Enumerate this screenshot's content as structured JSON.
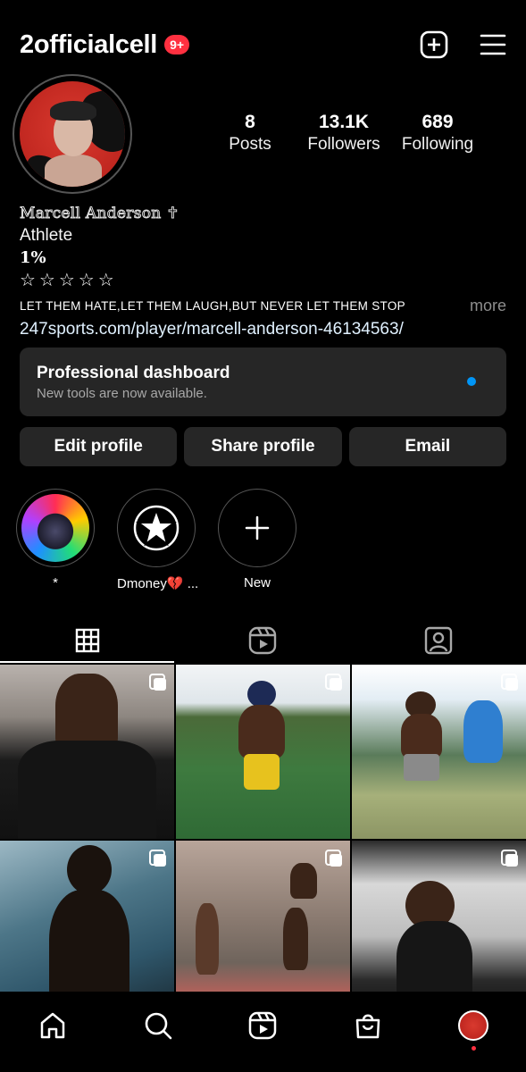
{
  "header": {
    "username": "2officialcell",
    "notification_badge": "9+",
    "icons": [
      "create-icon",
      "menu-icon"
    ]
  },
  "stats": [
    {
      "number": "8",
      "label": "Posts"
    },
    {
      "number": "13.1K",
      "label": "Followers"
    },
    {
      "number": "689",
      "label": "Following"
    }
  ],
  "bio": {
    "name": "Marcell Anderson ✝",
    "category": "Athlete",
    "line1": "1%",
    "stars": "☆☆☆☆☆",
    "motto": "LET THEM HATE,LET THEM LAUGH,BUT NEVER LET THEM STOP",
    "more": "more",
    "link": "247sports.com/player/marcell-anderson-46134563/"
  },
  "dashboard": {
    "title": "Professional dashboard",
    "subtitle": "New tools are now available."
  },
  "buttons": {
    "edit": "Edit profile",
    "share": "Share profile",
    "email": "Email"
  },
  "highlights": [
    {
      "label": "*"
    },
    {
      "label": "Dmoney💔 ..."
    },
    {
      "label": "New"
    }
  ],
  "tabs": [
    "grid-icon",
    "reels-icon",
    "tagged-icon"
  ],
  "grid": {
    "post_count": 6
  },
  "nav": [
    "home-icon",
    "search-icon",
    "reels-icon",
    "shop-icon",
    "profile-avatar"
  ],
  "colors": {
    "background": "#000000",
    "card": "#262626",
    "badge": "#ff3040",
    "accent_blue": "#0095f6",
    "muted": "#8e8e8e"
  }
}
